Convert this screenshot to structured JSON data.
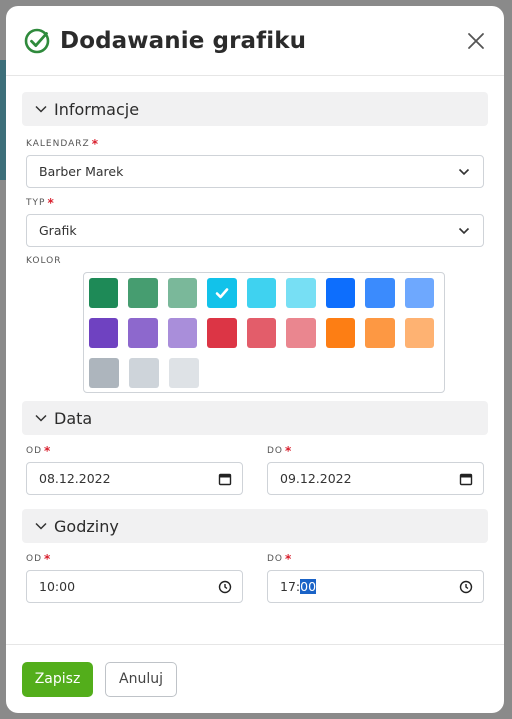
{
  "modal": {
    "title": "Dodawanie grafiku"
  },
  "sections": {
    "info": "Informacje",
    "date": "Data",
    "hours": "Godziny"
  },
  "fields": {
    "calendar": {
      "label": "KALENDARZ",
      "required": "*",
      "value": "Barber Marek"
    },
    "type": {
      "label": "TYP",
      "required": "*",
      "value": "Grafik"
    },
    "color": {
      "label": "KOLOR"
    },
    "date_from": {
      "label": "OD",
      "required": "*",
      "value": "08.12.2022"
    },
    "date_to": {
      "label": "DO",
      "required": "*",
      "value": "09.12.2022"
    },
    "time_from": {
      "label": "OD",
      "required": "*",
      "value": "10:00"
    },
    "time_to": {
      "label": "DO",
      "required": "*",
      "value_hours": "17:",
      "value_minutes_selected": "00"
    }
  },
  "palette": {
    "selected_index": 3,
    "rows": [
      [
        "#1e8a57",
        "#469d70",
        "#7ab89a",
        "#12c2ea",
        "#3fd2f0",
        "#77dff4",
        "#0d6efd",
        "#3b8bfd",
        "#6ea8fe"
      ],
      [
        "#6f42c1",
        "#8d68cd",
        "#a98eda",
        "#dc3545",
        "#e35d6a",
        "#ea868f",
        "#fd7e14",
        "#fd9843",
        "#feb272"
      ],
      [
        "#adb5bd",
        "#ced4da",
        "#dee2e6"
      ]
    ]
  },
  "footer": {
    "save": "Zapisz",
    "cancel": "Anuluj"
  },
  "colors": {
    "accent": "#53ae1b",
    "required": "#d9202e",
    "selection": "#1a63c7"
  }
}
